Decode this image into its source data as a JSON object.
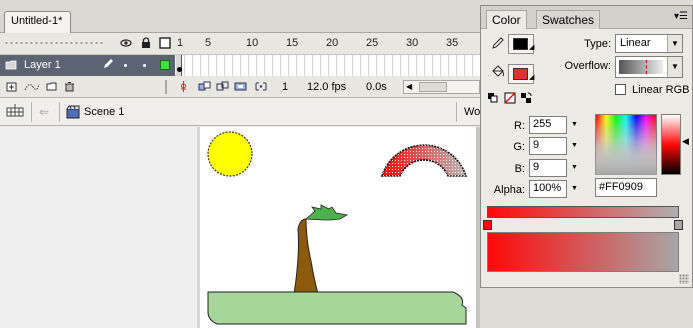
{
  "document": {
    "tab_title": "Untitled-1*"
  },
  "timeline": {
    "frame_numbers": [
      "1",
      "5",
      "10",
      "15",
      "20",
      "25",
      "30",
      "35"
    ],
    "layer": {
      "name": "Layer 1"
    },
    "footer": {
      "current_frame": "1",
      "frame_rate": "12.0 fps",
      "elapsed_time": "0.0s"
    }
  },
  "edit_bar": {
    "scene_label": "Scene 1",
    "workspace_label": "Wo"
  },
  "color_panel": {
    "tabs": [
      {
        "label": "Color"
      },
      {
        "label": "Swatches"
      }
    ],
    "type_label": "Type:",
    "type_value": "Linear",
    "overflow_label": "Overflow:",
    "linear_rgb_label": "Linear RGB",
    "r_label": "R:",
    "r_value": "255",
    "g_label": "G:",
    "g_value": "9",
    "b_label": "B:",
    "b_value": "9",
    "alpha_label": "Alpha:",
    "alpha_value": "100%",
    "hex_value": "#FF0909",
    "colors": {
      "stroke": "#000000",
      "fill": "#E03030",
      "gradient_start": "#FF0909",
      "gradient_end": "#A7A7A7"
    }
  },
  "icons": [
    "eye-icon",
    "lock-icon",
    "outline-icon",
    "pencil-icon",
    "paint-bucket-icon",
    "trash-icon",
    "back-arrow-icon",
    "scene-icon",
    "edit-symbols-icon"
  ]
}
